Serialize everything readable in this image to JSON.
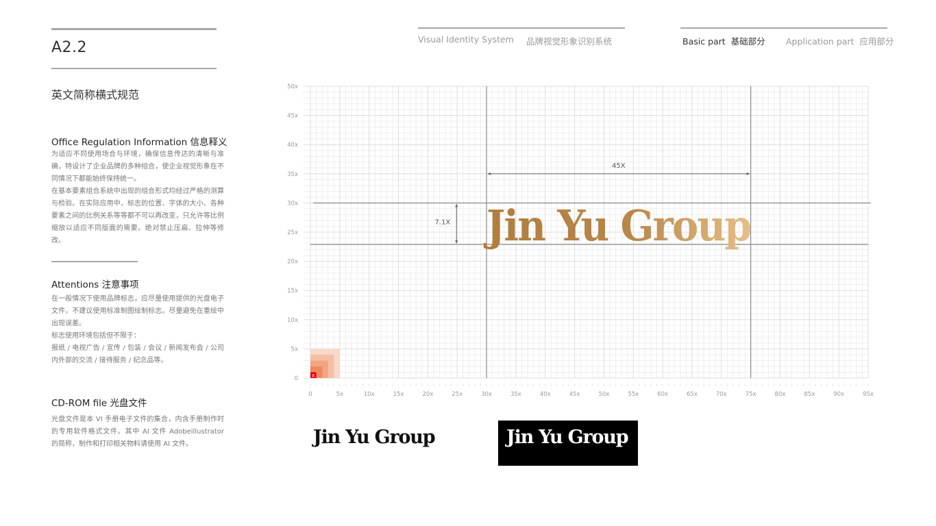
{
  "header": {
    "section_code": "A2.2",
    "page_title": "英文简称横式规范",
    "nav_center": {
      "left_label": "Visual Identity System",
      "right_label": "品牌视觉形象识别系统"
    },
    "nav_right": {
      "basic_label": "Basic part  基础部分",
      "application_label": "Application part  应用部分",
      "active": "basic"
    }
  },
  "sections": [
    {
      "title": "Office Regulation Information 信息释义",
      "paragraphs": [
        "为适应不同使用场合与环境，确保信息传达的清晰与准确，特设计了企业品牌的多种组合，使企业视觉形象在不同情况下都能始终保持统一。",
        "在基本要素组合系统中出现的组合形式均经过严格的测算与检验。在实际应用中，标志的位置、字体的大小、各种要素之间的比例关系等等都不可以再改变，只允许等比例缩放以适应不同版面的需要。绝对禁止压扁、拉伸等修改。"
      ]
    },
    {
      "title": "Attentions 注意事项",
      "paragraphs": [
        "在一般情况下使用品牌标志，应尽量使用提供的光盘电子文件，不建议使用标准制图绘制标志。尽量避免在重绘中出现误差。",
        "标志使用环境包括但不限于：",
        "报纸 / 电视广告 / 宣传 / 包装 / 会议 / 新闻发布会 / 公司内外部的交流 / 接待服务 / 纪念品等。"
      ]
    },
    {
      "title": "CD-ROM file 光盘文件",
      "paragraphs": [
        "光盘文件是本 VI 手册电子文件的集合，内含手册制作时的专用软件格式文件。其中 AI 文件 Adobeillustrator 的简称，制作和打印相关物料请使用 AI 文件。"
      ]
    }
  ],
  "grid": {
    "x_range": [
      0,
      95
    ],
    "y_range": [
      0,
      50
    ],
    "major_step": 5,
    "minor_step": 1,
    "x_ticks": [
      "0",
      "5x",
      "10x",
      "15x",
      "20x",
      "25x",
      "30x",
      "35x",
      "40x",
      "45x",
      "50x",
      "55x",
      "60x",
      "65x",
      "70x",
      "75x",
      "80x",
      "85x",
      "90x",
      "95x"
    ],
    "y_ticks": [
      "0",
      "5x",
      "10x",
      "15x",
      "20x",
      "25x",
      "30x",
      "35x",
      "40x",
      "45x",
      "50x"
    ],
    "unit_marker_label": "x",
    "unit_square_colors": [
      "#f8d9c9",
      "#f5bfa6",
      "#f2a583",
      "#ee8a5f",
      "#e60012"
    ],
    "vertical_guides_units": [
      30,
      75
    ],
    "horizontal_guides_units": [
      30,
      22.9
    ],
    "width_dimension": {
      "label": "45X",
      "from": 30,
      "to": 75,
      "at_y": 35
    },
    "height_dimension": {
      "label": "7.1X",
      "from": 22.9,
      "to": 30,
      "at_x": 25
    }
  },
  "logo": {
    "text": "Jin Yu Group",
    "gradient_start": "#b07d3e",
    "gradient_mid": "#b8874a",
    "gradient_end": "#e6bf88",
    "black_version_color": "#111111",
    "inverse_bg": "#000000",
    "inverse_text_color": "#ffffff"
  }
}
